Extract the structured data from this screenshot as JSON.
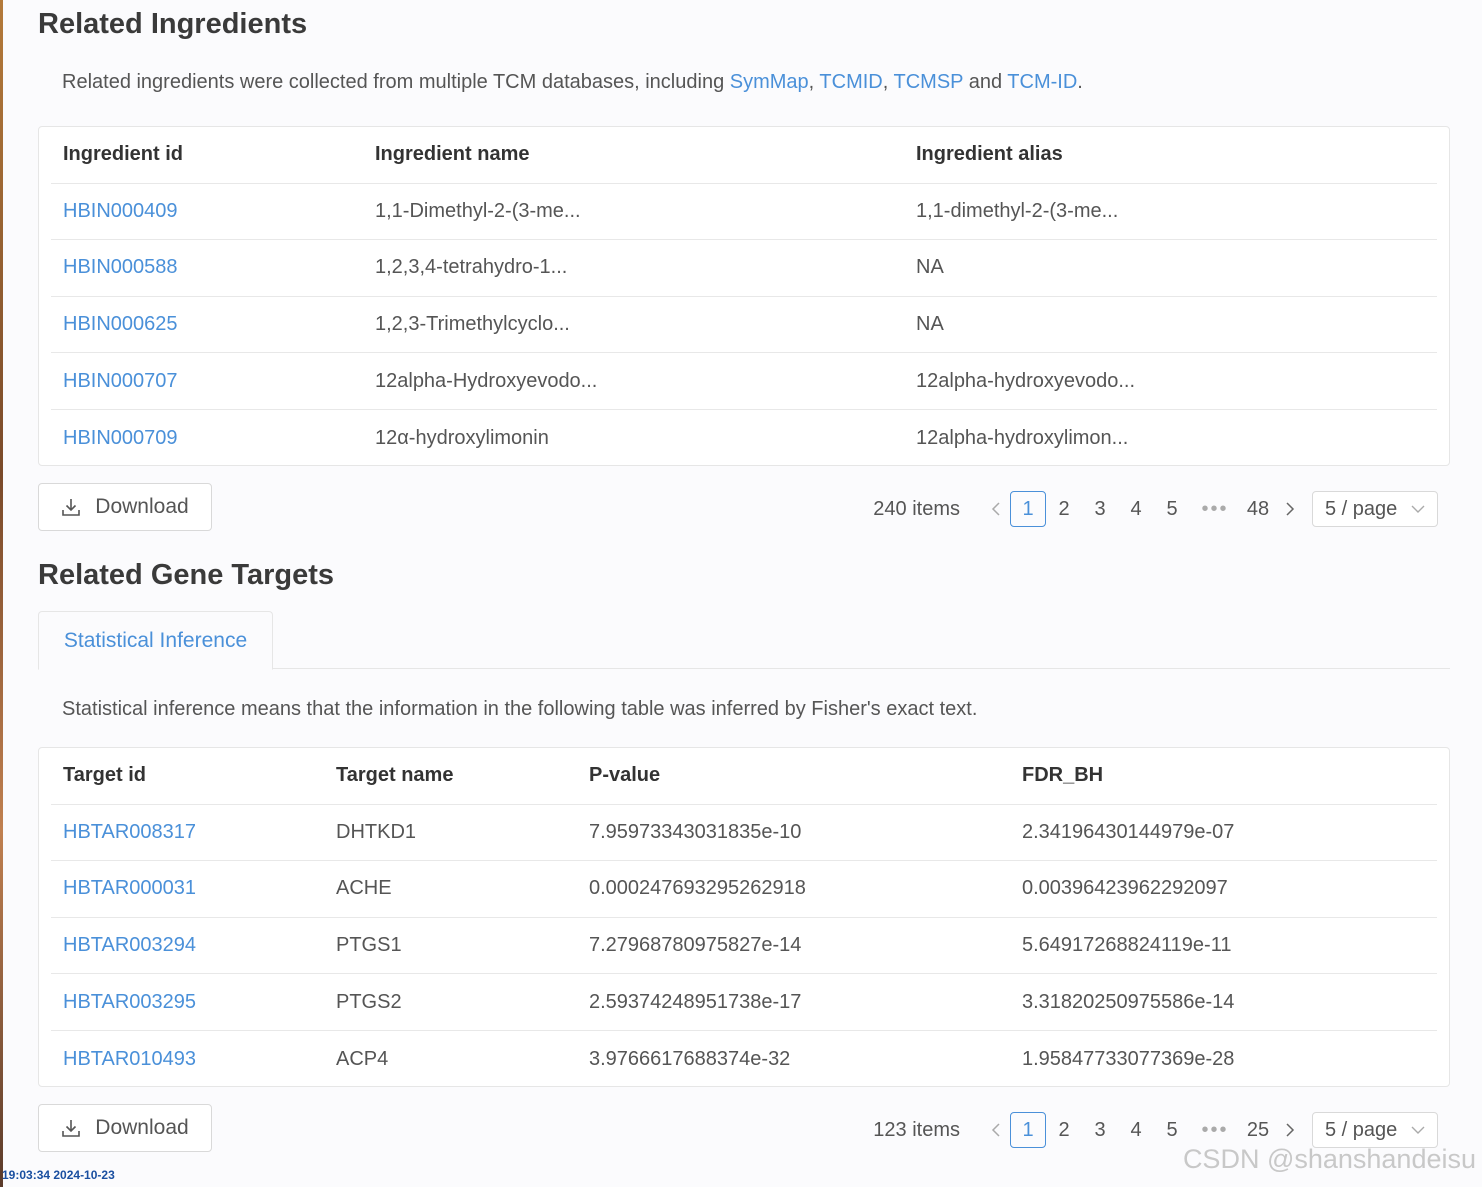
{
  "ingredients": {
    "title": "Related Ingredients",
    "desc_prefix": "Related ingredients were collected from multiple TCM databases, including",
    "links": [
      "SymMap",
      "TCMID",
      "TCMSP",
      "TCM-ID"
    ],
    "sep_comma": ",",
    "sep_and": "and",
    "desc_end": ".",
    "columns": [
      "Ingredient id",
      "Ingredient name",
      "Ingredient alias"
    ],
    "rows": [
      [
        "HBIN000409",
        "1,1-Dimethyl-2-(3-me...",
        "1,1-dimethyl-2-(3-me..."
      ],
      [
        "HBIN000588",
        "1,2,3,4-tetrahydro-1...",
        "NA"
      ],
      [
        "HBIN000625",
        "1,2,3-Trimethylcyclo...",
        "NA"
      ],
      [
        "HBIN000707",
        "12alpha-Hydroxyevodo...",
        "12alpha-hydroxyevodo..."
      ],
      [
        "HBIN000709",
        "12α-hydroxylimonin",
        "12alpha-hydroxylimon..."
      ]
    ],
    "download_label": "Download",
    "pagination": {
      "total": "240 items",
      "pages": [
        "1",
        "2",
        "3",
        "4",
        "5",
        "•••",
        "48"
      ],
      "active": "1",
      "page_size": "5 / page"
    }
  },
  "targets": {
    "title": "Related Gene Targets",
    "tab_label": "Statistical Inference",
    "desc": "Statistical inference means that the information in the following table was inferred by Fisher's exact text.",
    "columns": [
      "Target id",
      "Target name",
      "P-value",
      "FDR_BH"
    ],
    "rows": [
      [
        "HBTAR008317",
        "DHTKD1",
        "7.95973343031835e-10",
        "2.34196430144979e-07"
      ],
      [
        "HBTAR000031",
        "ACHE",
        "0.000247693295262918",
        "0.00396423962292097"
      ],
      [
        "HBTAR003294",
        "PTGS1",
        "7.27968780975827e-14",
        "5.64917268824119e-11"
      ],
      [
        "HBTAR003295",
        "PTGS2",
        "2.59374248951738e-17",
        "3.31820250975586e-14"
      ],
      [
        "HBTAR010493",
        "ACP4",
        "3.9766617688374e-32",
        "1.95847733077369e-28"
      ]
    ],
    "download_label": "Download",
    "pagination": {
      "total": "123 items",
      "pages": [
        "1",
        "2",
        "3",
        "4",
        "5",
        "•••",
        "25"
      ],
      "active": "1",
      "page_size": "5 / page"
    }
  },
  "overlay": {
    "timestamp": "19:03:34 2024-10-23",
    "watermark": "CSDN @shanshandeisu"
  },
  "colors": {
    "link": "#4a90d9",
    "text": "#555555",
    "border": "#e6e6e6"
  },
  "icons": [
    "download-icon",
    "chevron-left-icon",
    "chevron-right-icon",
    "chevron-down-icon"
  ]
}
